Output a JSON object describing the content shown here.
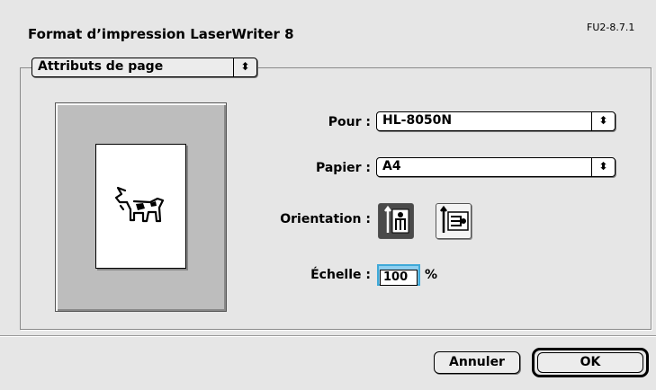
{
  "dialog": {
    "title": "Format d’impression LaserWriter 8",
    "version": "FU2-8.7.1"
  },
  "section": {
    "selected": "Attributs de page"
  },
  "preview": {
    "image": "dogcow"
  },
  "form": {
    "pour_label": "Pour :",
    "pour_value": "HL-8050N",
    "papier_label": "Papier :",
    "papier_value": "A4",
    "orientation_label": "Orientation :",
    "orientation_selected": "portrait",
    "orientation_options": [
      "portrait",
      "landscape"
    ],
    "echelle_label": "Échelle :",
    "echelle_value": "100",
    "echelle_unit": "%"
  },
  "buttons": {
    "cancel_label": "Annuler",
    "ok_label": "OK"
  },
  "icons": {
    "popup_arrows": "⬍"
  }
}
